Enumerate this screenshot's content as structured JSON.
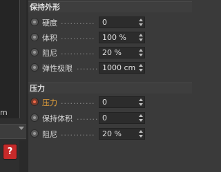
{
  "left_panel": {
    "partial_text": "m",
    "help_icon_label": "?"
  },
  "sections": [
    {
      "title": "保持外形",
      "rows": [
        {
          "label": "硬度",
          "dots": "...........",
          "value": "0",
          "active": false
        },
        {
          "label": "体积",
          "dots": "...........",
          "value": "100 %",
          "active": false
        },
        {
          "label": "阻尼",
          "dots": "...........",
          "value": "20 %",
          "active": false
        },
        {
          "label": "弹性极限",
          "dots": ".......",
          "value": "1000 cm",
          "active": false
        }
      ]
    },
    {
      "title": "压力",
      "rows": [
        {
          "label": "压力",
          "dots": "...........",
          "value": "0",
          "active": true
        },
        {
          "label": "保持体积",
          "dots": ".......",
          "value": "0",
          "active": false
        },
        {
          "label": "阻尼",
          "dots": "...........",
          "value": "20 %",
          "active": false
        }
      ]
    }
  ],
  "colors": {
    "active_label": "#e8a33a",
    "help_button": "#c62a2a",
    "panel_bg": "#3a3a3a"
  }
}
